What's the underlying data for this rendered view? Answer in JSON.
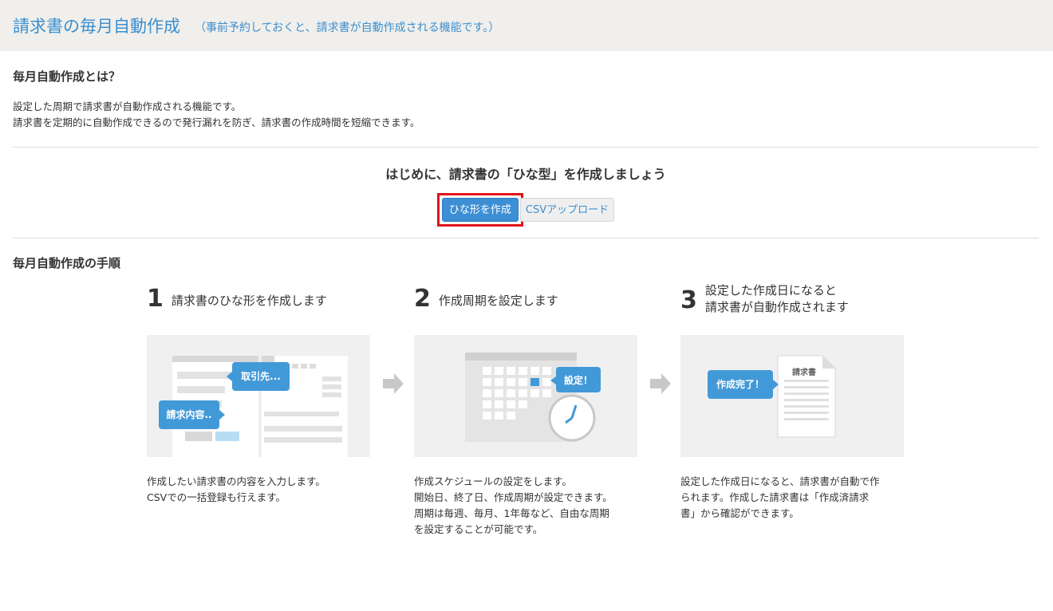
{
  "header": {
    "title": "請求書の毎月自動作成",
    "subtitle": "（事前予約しておくと、請求書が自動作成される機能です。）"
  },
  "about": {
    "title": "毎月自動作成とは？",
    "lines": [
      "設定した周期で請求書が自動作成される機能です。",
      "請求書を定期的に自動作成できるので発行漏れを防ぎ、請求書の作成時間を短縮できます。"
    ]
  },
  "template": {
    "heading": "はじめに、請求書の「ひな型」を作成しましょう",
    "create_button": "ひな形を作成",
    "csv_button": "CSVアップロード"
  },
  "steps_section": {
    "title": "毎月自動作成の手順",
    "steps": [
      {
        "number": "1",
        "label_lines": [
          "請求書のひな形を作成します"
        ],
        "bubbles": [
          "取引先...",
          "請求内容.."
        ],
        "text_lines": [
          "作成したい請求書の内容を入力します。",
          "CSVでの一括登録も行えます。"
        ]
      },
      {
        "number": "2",
        "label_lines": [
          "作成周期を設定します"
        ],
        "bubbles": [
          "設定！"
        ],
        "text_lines": [
          "作成スケジュールの設定をします。",
          "開始日、終了日、作成周期が設定できます。",
          "周期は毎週、毎月、1年毎など、自由な周期",
          "を設定することが可能です。"
        ]
      },
      {
        "number": "3",
        "label_lines": [
          "設定した作成日になると",
          "請求書が自動作成されます"
        ],
        "bubbles": [
          "作成完了！"
        ],
        "doc_title": "請求書",
        "text_lines": [
          "設定した作成日になると、請求書が自動で作",
          "られます。作成した請求書は「作成済請求",
          "書」から確認ができます。"
        ]
      }
    ]
  },
  "colors": {
    "accent": "#3b8fd0",
    "bubble": "#4299d8",
    "highlight": "#e0131b",
    "header_bg": "#f0efeb"
  }
}
